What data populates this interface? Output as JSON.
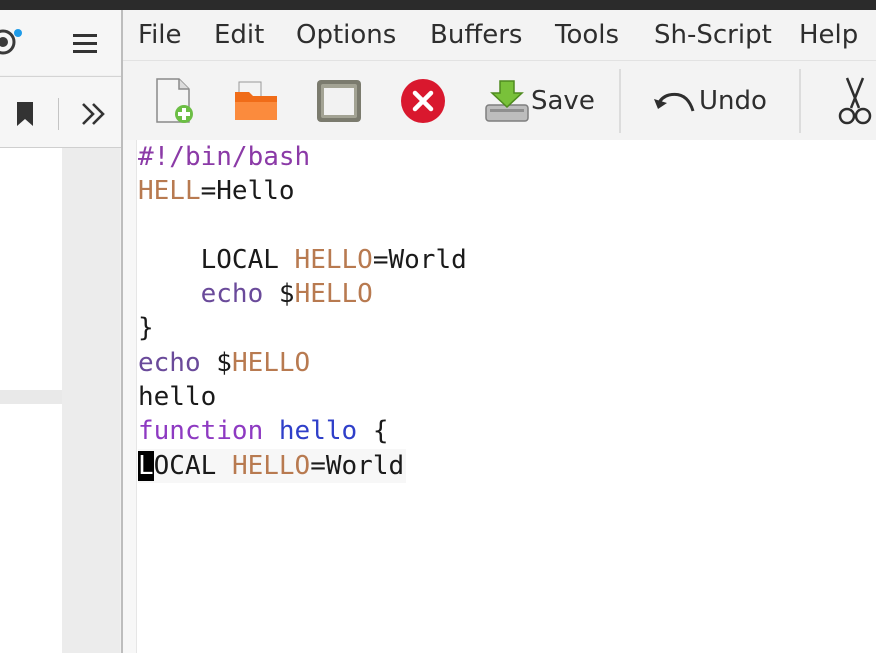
{
  "menu": {
    "items": [
      "File",
      "Edit",
      "Options",
      "Buffers",
      "Tools",
      "Sh-Script",
      "Help"
    ]
  },
  "toolbar": {
    "save_label": "Save",
    "undo_label": "Undo"
  },
  "left_panel": {
    "icons": [
      "extension-icon",
      "menu-icon",
      "bookmark-icon",
      "overflow-icon"
    ]
  },
  "code": {
    "line1": "#!/bin/bash",
    "line2": {
      "var": "HELL",
      "rest": "=Hello"
    },
    "line3": "",
    "line4": {
      "indent": "    ",
      "cmd": "LOCAL ",
      "var": "HELLO",
      "rest": "=World"
    },
    "line5": {
      "indent": "    ",
      "cmd": "echo ",
      "dollar": "$",
      "var": "HELLO"
    },
    "line6": "}",
    "line7": {
      "cmd": "echo ",
      "dollar": "$",
      "var": "HELLO"
    },
    "line8": "hello",
    "line9": {
      "kw": "function ",
      "name": "hello",
      "rest": " {"
    },
    "line10": {
      "cursor": "L",
      "cmd": "OCAL ",
      "var": "HELLO",
      "rest": "=World"
    }
  },
  "colors": {
    "shebang": "#a0522d",
    "variable": "#b87a50",
    "builtin": "#6a4a9a",
    "keyword": "#8e3ac2",
    "function_name": "#2f3fc9",
    "close_button": "#d9182e"
  }
}
